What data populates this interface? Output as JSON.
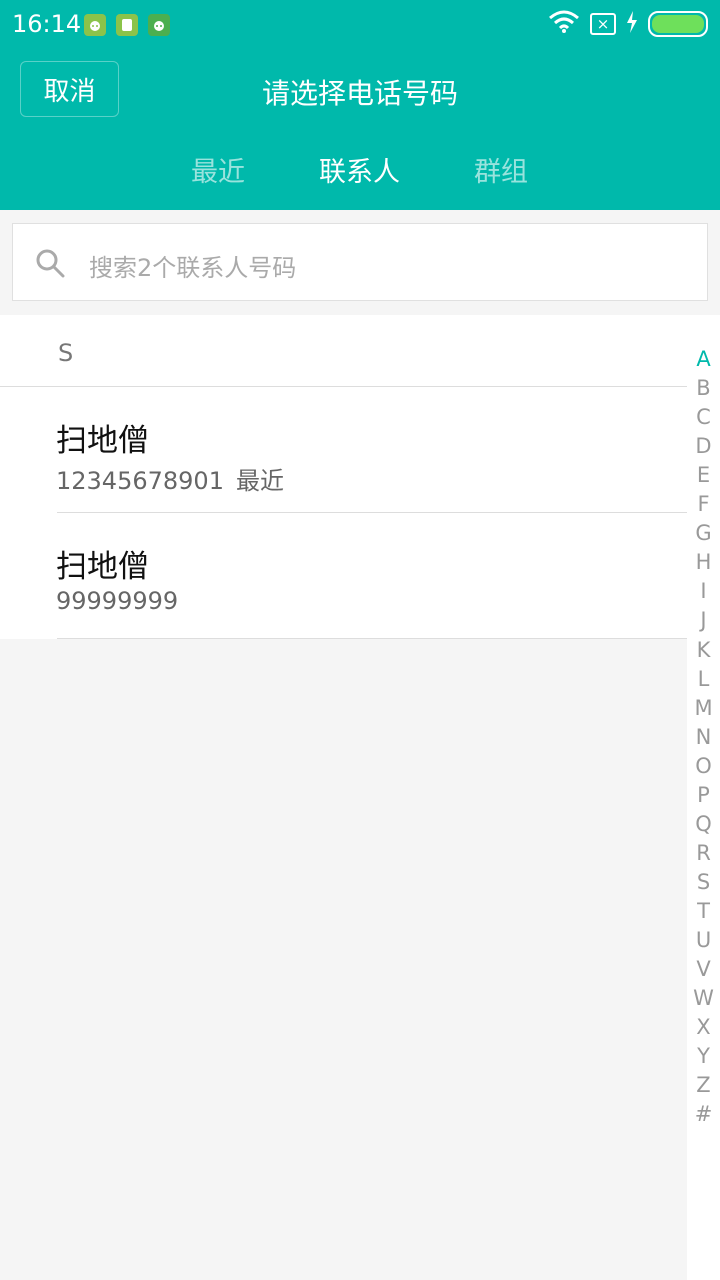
{
  "status_bar": {
    "time": "16:14",
    "notification_icons": [
      "android-app-icon",
      "sim-card-icon",
      "android-app-icon"
    ],
    "right_icons": [
      "wifi-icon",
      "no-sim-icon",
      "charging-icon",
      "battery-icon"
    ],
    "battery_level": 1.0
  },
  "header": {
    "cancel_label": "取消",
    "title": "请选择电话号码",
    "tabs": [
      {
        "label": "最近",
        "active": false
      },
      {
        "label": "联系人",
        "active": true
      },
      {
        "label": "群组",
        "active": false
      }
    ]
  },
  "search": {
    "placeholder": "搜索2个联系人号码"
  },
  "contacts": {
    "section_letter": "S",
    "items": [
      {
        "name": "扫地僧",
        "number": "12345678901",
        "tag": "最近"
      },
      {
        "name": "扫地僧",
        "number": "99999999",
        "tag": ""
      }
    ]
  },
  "index_bar": {
    "letters": [
      "A",
      "B",
      "C",
      "D",
      "E",
      "F",
      "G",
      "H",
      "I",
      "J",
      "K",
      "L",
      "M",
      "N",
      "O",
      "P",
      "Q",
      "R",
      "S",
      "T",
      "U",
      "V",
      "W",
      "X",
      "Y",
      "Z",
      "#"
    ],
    "active": "A"
  },
  "colors": {
    "accent": "#00b9ab",
    "background": "#f5f5f5"
  }
}
